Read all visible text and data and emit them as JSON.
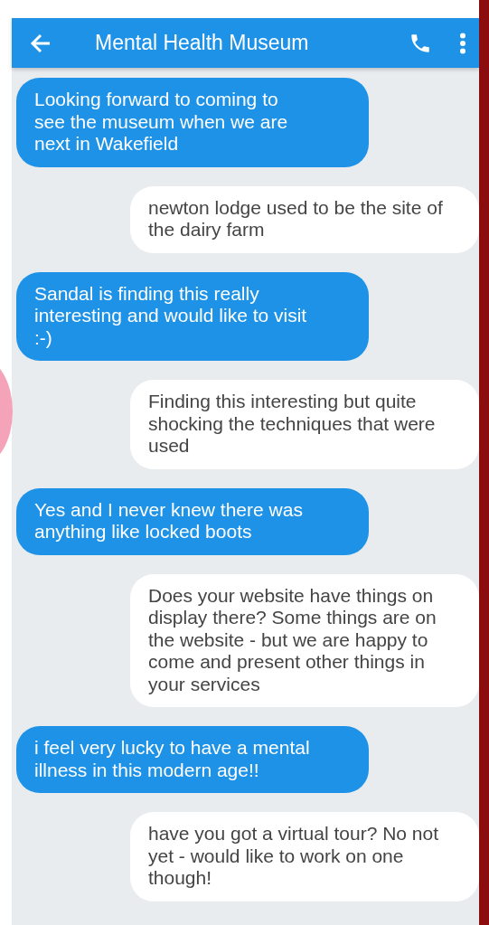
{
  "header": {
    "title": "Mental Health Museum"
  },
  "messages": [
    {
      "kind": "incoming",
      "text": "Looking forward to coming to see the museum when we are next in Wakefield"
    },
    {
      "kind": "outgoing",
      "text": "newton lodge used to be the site of the dairy farm"
    },
    {
      "kind": "incoming",
      "text": "Sandal is finding this really interesting and would like to visit :-)"
    },
    {
      "kind": "outgoing",
      "text": "Finding this interesting but quite shocking the techniques that were used"
    },
    {
      "kind": "incoming",
      "text": "Yes and I never knew there was anything like locked boots"
    },
    {
      "kind": "outgoing",
      "text": "Does your website have things on display there? Some things are on the website - but we are happy to come and present other things in your services"
    },
    {
      "kind": "incoming",
      "text": "i feel very lucky to have a mental illness in this modern age!!"
    },
    {
      "kind": "outgoing",
      "text": "have you got a virtual tour? No not yet - would like to work on one though!"
    }
  ]
}
